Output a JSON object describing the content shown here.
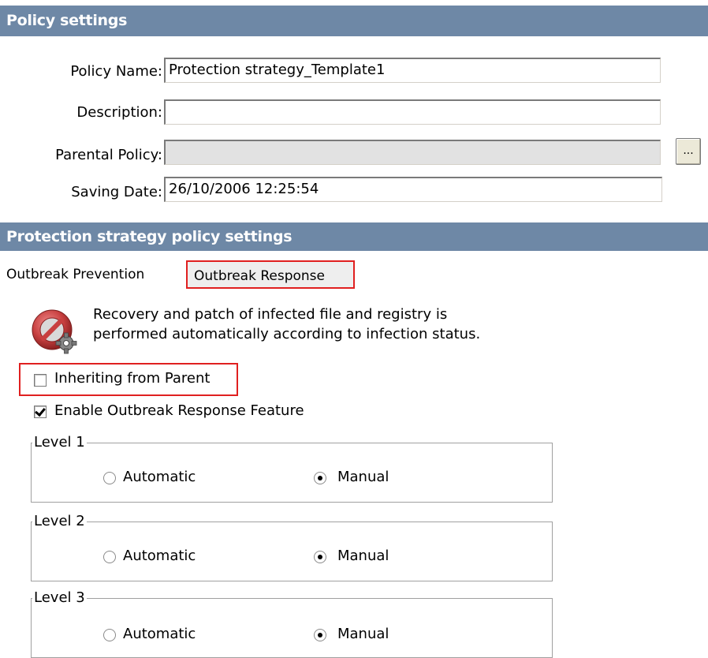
{
  "policy_settings": {
    "header": "Policy settings",
    "fields": [
      {
        "label": "Policy Name:",
        "value": "Protection strategy_Template1"
      },
      {
        "label": "Description:",
        "value": ""
      },
      {
        "label": "Parental Policy:",
        "value": ""
      },
      {
        "label": "Saving Date:",
        "value": "26/10/2006 12:25:54"
      }
    ],
    "browse_label": "..."
  },
  "strategy": {
    "header": "Protection strategy policy settings",
    "tabs": [
      {
        "label": "Outbreak Prevention",
        "active": false
      },
      {
        "label": "Outbreak Response",
        "active": true
      }
    ],
    "info_line1": "Recovery and patch of infected file and registry is",
    "info_line2": "performed automatically according to infection status.",
    "info_icon": "no-entry-gear-icon",
    "inherit_label": "Inheriting from Parent",
    "inherit_checked": false,
    "enable_label": "Enable Outbreak Response Feature",
    "enable_checked": true,
    "levels": [
      {
        "legend": "Level 1",
        "automatic_label": "Automatic",
        "manual_label": "Manual",
        "selected": "Manual"
      },
      {
        "legend": "Level 2",
        "automatic_label": "Automatic",
        "manual_label": "Manual",
        "selected": "Manual"
      },
      {
        "legend": "Level 3",
        "automatic_label": "Automatic",
        "manual_label": "Manual",
        "selected": "Manual"
      }
    ]
  },
  "colors": {
    "header_bg": "#6e88a6",
    "highlight": "#e02020"
  }
}
